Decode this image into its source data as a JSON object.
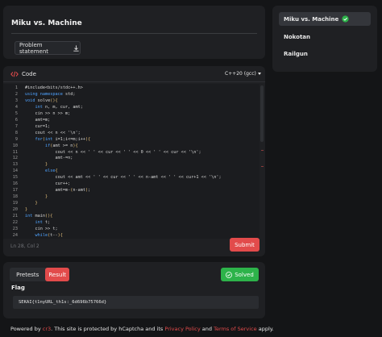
{
  "problem": {
    "title": "Miku vs. Machine",
    "statement_button": "Problem statement"
  },
  "sidebar": {
    "items": [
      {
        "label": "Miku vs. Machine",
        "solved": true
      },
      {
        "label": "Nokotan",
        "solved": false
      },
      {
        "label": "Railgun",
        "solved": false
      }
    ]
  },
  "editor": {
    "title": "Code",
    "language": "C++20 (gcc)",
    "cursor_position": "Ln 28, Col 2",
    "submit_label": "Submit",
    "lines": [
      {
        "no": "1",
        "text": "#include<bits/stdc++.h>"
      },
      {
        "no": "2",
        "text": "using namespace std;"
      },
      {
        "no": "3",
        "text": "void solve(){"
      },
      {
        "no": "4",
        "text": "    int n, m, cur, amt;"
      },
      {
        "no": "5",
        "text": "    cin >> n >> m;"
      },
      {
        "no": "6",
        "text": "    amt=m;"
      },
      {
        "no": "7",
        "text": "    cur=1;"
      },
      {
        "no": "8",
        "text": "    cout << n << '\\n';"
      },
      {
        "no": "9",
        "text": "    for(int i=1;i<=m;i++){"
      },
      {
        "no": "10",
        "text": "        if(amt >= n){"
      },
      {
        "no": "11",
        "text": "            cout << n << ' ' << cur << ' ' << 0 << ' ' << cur << '\\n';"
      },
      {
        "no": "12",
        "text": "            amt-=n;"
      },
      {
        "no": "13",
        "text": "        }"
      },
      {
        "no": "14",
        "text": "        else{"
      },
      {
        "no": "15",
        "text": "            cout << amt << ' ' << cur << ' ' << n-amt << ' ' << cur+1 << '\\n';"
      },
      {
        "no": "16",
        "text": "            cur++;"
      },
      {
        "no": "17",
        "text": "            amt=m-(n-amt);"
      },
      {
        "no": "18",
        "text": "        }"
      },
      {
        "no": "19",
        "text": "    }"
      },
      {
        "no": "20",
        "text": "}"
      },
      {
        "no": "21",
        "text": "int main(){"
      },
      {
        "no": "22",
        "text": "    int t;"
      },
      {
        "no": "23",
        "text": "    cin >> t;"
      },
      {
        "no": "24",
        "text": "    while(t--){"
      }
    ]
  },
  "results": {
    "tab_pretests": "Pretests",
    "tab_result": "Result",
    "status": "Solved",
    "flag_label": "Flag",
    "flag_value": "SEKAI{t1nyURL_th1s:_6d696b75766d}"
  },
  "footer": {
    "prefix": "Powered by ",
    "link1": "cr3",
    "middle": ". This site is protected by hCaptcha and its ",
    "link2": "Privacy Policy",
    "and": " and ",
    "link3": "Terms of Service",
    "suffix": " apply."
  },
  "colors": {
    "accent": "#e24b4b",
    "success": "#2db34a",
    "background": "#141517",
    "panel": "#1f2023"
  }
}
